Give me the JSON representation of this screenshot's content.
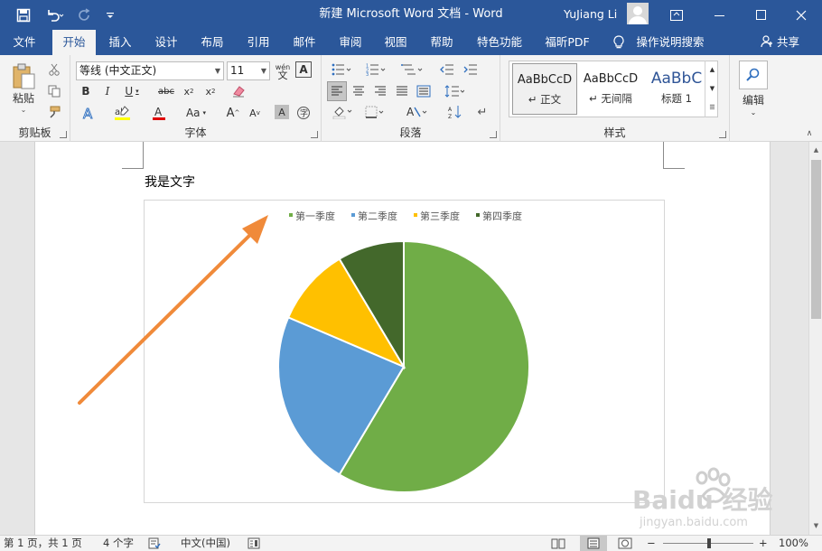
{
  "app": {
    "title": "新建 Microsoft Word 文档  -  Word",
    "user": "YuJiang Li"
  },
  "tabs": [
    {
      "label": "文件"
    },
    {
      "label": "开始",
      "active": true
    },
    {
      "label": "插入"
    },
    {
      "label": "设计"
    },
    {
      "label": "布局"
    },
    {
      "label": "引用"
    },
    {
      "label": "邮件"
    },
    {
      "label": "审阅"
    },
    {
      "label": "视图"
    },
    {
      "label": "帮助"
    },
    {
      "label": "特色功能"
    },
    {
      "label": "福昕PDF"
    },
    {
      "label": "操作说明搜索"
    },
    {
      "label": "共享"
    }
  ],
  "ribbon": {
    "clipboard": {
      "paste": "粘贴",
      "label": "剪贴板"
    },
    "font": {
      "name": "等线 (中文正文)",
      "size": "11",
      "wen": "wén",
      "label": "字体"
    },
    "paragraph": {
      "label": "段落"
    },
    "styles": {
      "items": [
        {
          "preview": "AaBbCcD",
          "name": "↵ 正文"
        },
        {
          "preview": "AaBbCcD",
          "name": "↵ 无间隔"
        },
        {
          "preview": "AaBbC",
          "name": "标题 1"
        }
      ],
      "label": "样式"
    },
    "editing": {
      "label": "编辑"
    }
  },
  "document": {
    "text": "我是文字"
  },
  "chart_data": {
    "type": "pie",
    "categories": [
      "第一季度",
      "第二季度",
      "第三季度",
      "第四季度"
    ],
    "values": [
      8.2,
      3.2,
      1.4,
      1.2
    ],
    "colors": [
      "#70ad47",
      "#5b9bd5",
      "#ffc000",
      "#43682b"
    ],
    "legend_position": "top",
    "title": ""
  },
  "statusbar": {
    "page": "第 1 页，共 1 页",
    "words": "4 个字",
    "language": "中文(中国)",
    "zoom": "100%"
  },
  "colors": {
    "accent": "#2b579a",
    "arrow": "#f08a3a"
  },
  "watermark": {
    "text": "Baidu 经验",
    "sub": "jingyan.baidu.com"
  }
}
